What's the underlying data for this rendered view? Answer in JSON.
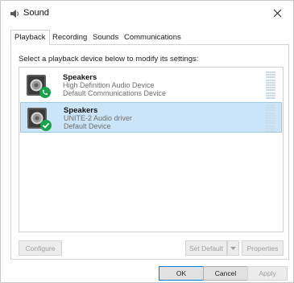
{
  "window": {
    "title": "Sound",
    "close_icon": "close-icon"
  },
  "tabs": [
    {
      "label": "Playback",
      "active": true
    },
    {
      "label": "Recording",
      "active": false
    },
    {
      "label": "Sounds",
      "active": false
    },
    {
      "label": "Communications",
      "active": false
    }
  ],
  "playback": {
    "instruction": "Select a playback device below to modify its settings:",
    "devices": [
      {
        "name": "Speakers",
        "line2": "High Definition Audio Device",
        "line3": "Default Communications Device",
        "badge_icon": "phone-icon",
        "selected": false
      },
      {
        "name": "Speakers",
        "line2": "UNITE-2 Audio driver",
        "line3": "Default Device",
        "badge_icon": "checkmark-icon",
        "selected": true
      }
    ],
    "buttons": {
      "configure": "Configure",
      "set_default": "Set Default",
      "properties": "Properties"
    }
  },
  "dialog_buttons": {
    "ok": "OK",
    "cancel": "Cancel",
    "apply": "Apply"
  },
  "colors": {
    "selection": "#cce4f7",
    "selection_border": "#99c9ef",
    "badge_green": "#16a34a",
    "accent": "#0078d7"
  }
}
